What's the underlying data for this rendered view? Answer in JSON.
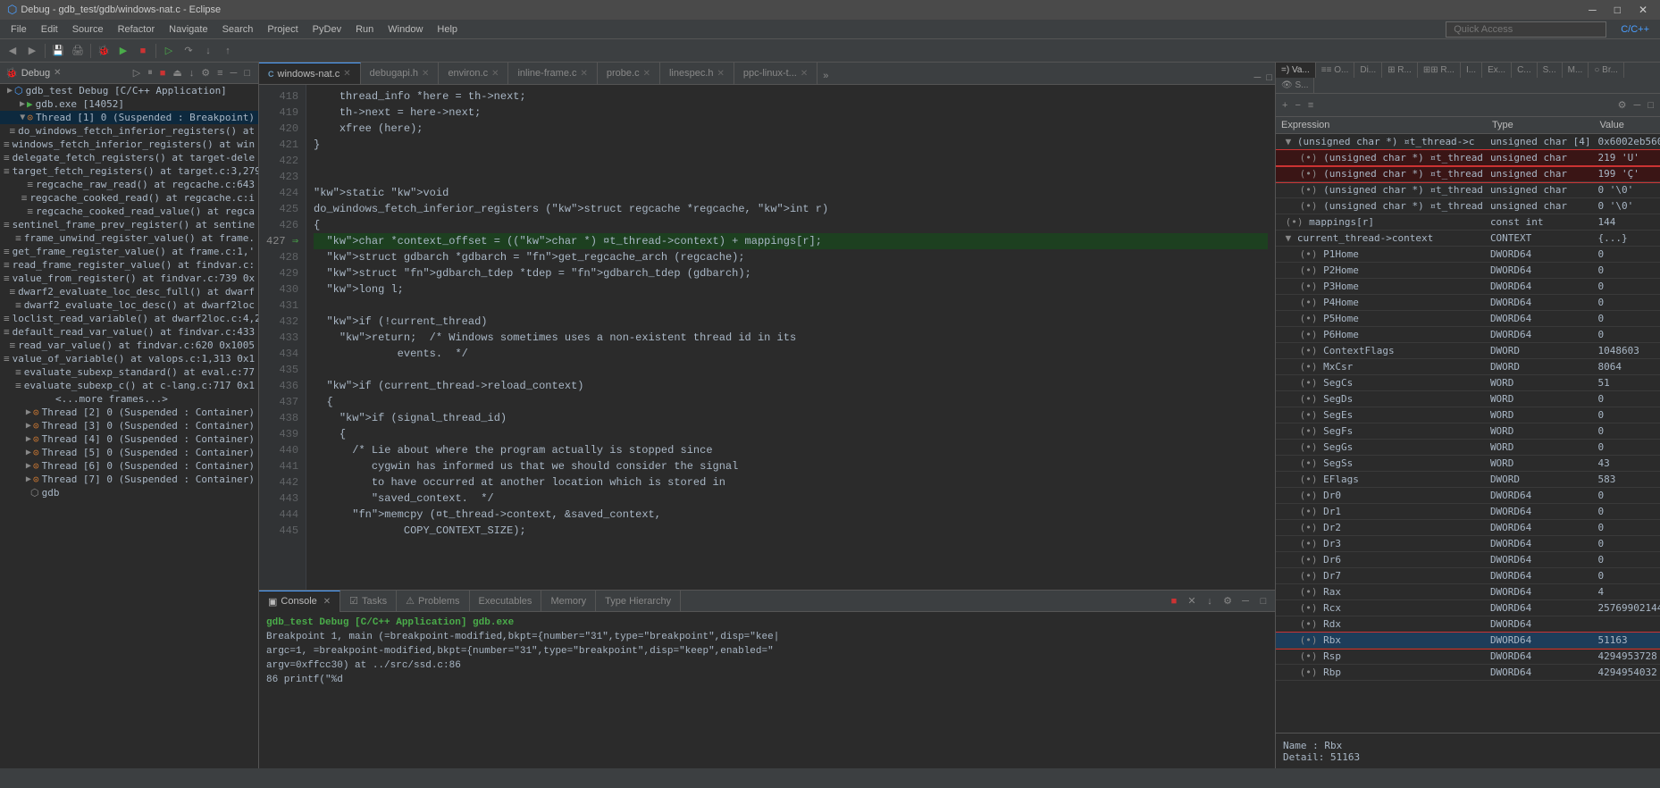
{
  "titleBar": {
    "title": "Debug - gdb_test/gdb/windows-nat.c - Eclipse",
    "controls": [
      "─",
      "□",
      "✕"
    ]
  },
  "menuBar": {
    "items": [
      "File",
      "Edit",
      "Source",
      "Refactor",
      "Navigate",
      "Search",
      "Project",
      "PyDev",
      "Run",
      "Window",
      "Help"
    ]
  },
  "toolbar": {
    "quickAccess": "Quick Access",
    "perspective": "C/C++"
  },
  "debugPanel": {
    "title": "Debug",
    "tree": [
      {
        "indent": 0,
        "icon": "▶",
        "label": "gdb_test Debug [C/C++ Application]",
        "type": "app"
      },
      {
        "indent": 1,
        "icon": "▶",
        "label": "gdb.exe [14052]",
        "type": "process"
      },
      {
        "indent": 2,
        "icon": "▼",
        "label": "Thread [1] 0 (Suspended : Breakpoint)",
        "type": "thread",
        "active": true
      },
      {
        "indent": 3,
        "label": "do_windows_fetch_inferior_registers() at",
        "type": "frame"
      },
      {
        "indent": 3,
        "label": "windows_fetch_inferior_registers() at win",
        "type": "frame"
      },
      {
        "indent": 3,
        "label": "delegate_fetch_registers() at target-dele",
        "type": "frame"
      },
      {
        "indent": 3,
        "label": "target_fetch_registers() at target.c:3,279",
        "type": "frame"
      },
      {
        "indent": 3,
        "label": "regcache_raw_read() at regcache.c:643",
        "type": "frame"
      },
      {
        "indent": 3,
        "label": "regcache_cooked_read() at regcache.c:i",
        "type": "frame"
      },
      {
        "indent": 3,
        "label": "regcache_cooked_read_value() at regca",
        "type": "frame"
      },
      {
        "indent": 3,
        "label": "sentinel_frame_prev_register() at sentine",
        "type": "frame"
      },
      {
        "indent": 3,
        "label": "frame_unwind_register_value() at frame.",
        "type": "frame"
      },
      {
        "indent": 3,
        "label": "get_frame_register_value() at frame.c:1,'",
        "type": "frame"
      },
      {
        "indent": 3,
        "label": "read_frame_register_value() at findvar.c:",
        "type": "frame"
      },
      {
        "indent": 3,
        "label": "value_from_register() at findvar.c:739 0x",
        "type": "frame"
      },
      {
        "indent": 3,
        "label": "dwarf2_evaluate_loc_desc_full() at dwarf",
        "type": "frame"
      },
      {
        "indent": 3,
        "label": "dwarf2_evaluate_loc_desc() at dwarf2loc",
        "type": "frame"
      },
      {
        "indent": 3,
        "label": "loclist_read_variable() at dwarf2loc.c:4,2",
        "type": "frame"
      },
      {
        "indent": 3,
        "label": "default_read_var_value() at findvar.c:433",
        "type": "frame"
      },
      {
        "indent": 3,
        "label": "read_var_value() at findvar.c:620 0x1005",
        "type": "frame"
      },
      {
        "indent": 3,
        "label": "value_of_variable() at valops.c:1,313 0x1",
        "type": "frame"
      },
      {
        "indent": 3,
        "label": "evaluate_subexp_standard() at eval.c:77",
        "type": "frame"
      },
      {
        "indent": 3,
        "label": "evaluate_subexp_c() at c-lang.c:717 0x1",
        "type": "frame"
      },
      {
        "indent": 3,
        "label": "<...more frames...>",
        "type": "more"
      },
      {
        "indent": 2,
        "icon": "▶",
        "label": "Thread [2] 0 (Suspended : Container)",
        "type": "thread"
      },
      {
        "indent": 2,
        "icon": "▶",
        "label": "Thread [3] 0 (Suspended : Container)",
        "type": "thread"
      },
      {
        "indent": 2,
        "icon": "▶",
        "label": "Thread [4] 0 (Suspended : Container)",
        "type": "thread"
      },
      {
        "indent": 2,
        "icon": "▶",
        "label": "Thread [5] 0 (Suspended : Container)",
        "type": "thread"
      },
      {
        "indent": 2,
        "icon": "▶",
        "label": "Thread [6] 0 (Suspended : Container)",
        "type": "thread"
      },
      {
        "indent": 2,
        "icon": "▶",
        "label": "Thread [7] 0 (Suspended : Container)",
        "type": "thread"
      },
      {
        "indent": 1,
        "label": "gdb",
        "type": "gdb"
      }
    ]
  },
  "editorTabs": {
    "tabs": [
      {
        "label": "windows-nat.c",
        "active": true,
        "icon": "C"
      },
      {
        "label": "debugapi.h",
        "active": false
      },
      {
        "label": "environ.c",
        "active": false
      },
      {
        "label": "inline-frame.c",
        "active": false
      },
      {
        "label": "probe.c",
        "active": false
      },
      {
        "label": "linespec.h",
        "active": false
      },
      {
        "label": "ppc-linux-t...",
        "active": false
      }
    ],
    "more": "»"
  },
  "codeLines": [
    {
      "num": 418,
      "code": "    thread_info *here = th->next;",
      "highlight": false
    },
    {
      "num": 419,
      "code": "    th->next = here->next;",
      "highlight": false
    },
    {
      "num": 420,
      "code": "    xfree (here);",
      "highlight": false
    },
    {
      "num": 421,
      "code": "}",
      "highlight": false
    },
    {
      "num": 422,
      "code": "",
      "highlight": false
    },
    {
      "num": 423,
      "code": "",
      "highlight": false
    },
    {
      "num": 424,
      "code": "static void",
      "highlight": false
    },
    {
      "num": 425,
      "code": "do_windows_fetch_inferior_registers (struct regcache *regcache, int r)",
      "highlight": false
    },
    {
      "num": 426,
      "code": "{",
      "highlight": false
    },
    {
      "num": 427,
      "code": "  char *context_offset = ((char *) &current_thread->context) + mappings[r];",
      "highlight": true
    },
    {
      "num": 428,
      "code": "  struct gdbarch *gdbarch = get_regcache_arch (regcache);",
      "highlight": false
    },
    {
      "num": 429,
      "code": "  struct gdbarch_tdep *tdep = gdbarch_tdep (gdbarch);",
      "highlight": false
    },
    {
      "num": 430,
      "code": "  long l;",
      "highlight": false
    },
    {
      "num": 431,
      "code": "",
      "highlight": false
    },
    {
      "num": 432,
      "code": "  if (!current_thread)",
      "highlight": false
    },
    {
      "num": 433,
      "code": "    return;  /* Windows sometimes uses a non-existent thread id in its",
      "highlight": false
    },
    {
      "num": 434,
      "code": "             events.  */",
      "highlight": false
    },
    {
      "num": 435,
      "code": "",
      "highlight": false
    },
    {
      "num": 436,
      "code": "  if (current_thread->reload_context)",
      "highlight": false
    },
    {
      "num": 437,
      "code": "  {",
      "highlight": false
    },
    {
      "num": 438,
      "code": "    if (signal_thread_id)",
      "highlight": false
    },
    {
      "num": 439,
      "code": "    {",
      "highlight": false
    },
    {
      "num": 440,
      "code": "      /* Lie about where the program actually is stopped since",
      "highlight": false
    },
    {
      "num": 441,
      "code": "         cygwin has informed us that we should consider the signal",
      "highlight": false
    },
    {
      "num": 442,
      "code": "         to have occurred at another location which is stored in",
      "highlight": false
    },
    {
      "num": 443,
      "code": "         \"saved_context.  */",
      "highlight": false
    },
    {
      "num": 444,
      "code": "      memcpy (&current_thread->context, &saved_context,",
      "highlight": false
    },
    {
      "num": 445,
      "code": "              COPY_CONTEXT_SIZE);",
      "highlight": false
    }
  ],
  "rightPanel": {
    "tabs": [
      {
        "label": "=) Va...",
        "active": true
      },
      {
        "label": "≡≡ O...",
        "active": false
      },
      {
        "label": "Di...",
        "active": false
      },
      {
        "label": "⊞⊞ R...",
        "active": false
      },
      {
        "label": "≡ R...",
        "active": false
      },
      {
        "label": "I...",
        "active": false
      },
      {
        "label": "Ex...",
        "active": false
      },
      {
        "label": "C...",
        "active": false
      },
      {
        "label": "S...",
        "active": false
      },
      {
        "label": "M...",
        "active": false
      },
      {
        "label": "○ Br...",
        "active": false
      },
      {
        "label": "👁 S...",
        "active": false
      }
    ],
    "tableHeaders": [
      "Expression",
      "Type",
      "Value"
    ],
    "variables": [
      {
        "indent": 0,
        "expand": "▼",
        "name": "(unsigned char *) &current_thread->c",
        "type": "unsigned char [4]",
        "value": "0x6002eb560",
        "selected": false,
        "redOutline": false
      },
      {
        "indent": 1,
        "expand": "(•)",
        "name": "(unsigned char *) &current_thread",
        "type": "unsigned char",
        "value": "219 'U'",
        "selected": false,
        "redOutline": true
      },
      {
        "indent": 1,
        "expand": "(•)",
        "name": "(unsigned char *) &current_thread",
        "type": "unsigned char",
        "value": "199 'Ç'",
        "selected": false,
        "redOutline": true
      },
      {
        "indent": 1,
        "expand": "(•)",
        "name": "(unsigned char *) &current_thread",
        "type": "unsigned char",
        "value": "0 '\\0'",
        "selected": false,
        "redOutline": false
      },
      {
        "indent": 1,
        "expand": "(•)",
        "name": "(unsigned char *) &current_thread",
        "type": "unsigned char",
        "value": "0 '\\0'",
        "selected": false,
        "redOutline": false
      },
      {
        "indent": 0,
        "expand": "(•)",
        "name": "mappings[r]",
        "type": "const int",
        "value": "144",
        "selected": false,
        "redOutline": false
      },
      {
        "indent": 0,
        "expand": "▼",
        "name": "current_thread->context",
        "type": "CONTEXT",
        "value": "{...}",
        "selected": false,
        "redOutline": false
      },
      {
        "indent": 1,
        "expand": "(•)",
        "name": "P1Home",
        "type": "DWORD64",
        "value": "0",
        "selected": false,
        "redOutline": false
      },
      {
        "indent": 1,
        "expand": "(•)",
        "name": "P2Home",
        "type": "DWORD64",
        "value": "0",
        "selected": false,
        "redOutline": false
      },
      {
        "indent": 1,
        "expand": "(•)",
        "name": "P3Home",
        "type": "DWORD64",
        "value": "0",
        "selected": false,
        "redOutline": false
      },
      {
        "indent": 1,
        "expand": "(•)",
        "name": "P4Home",
        "type": "DWORD64",
        "value": "0",
        "selected": false,
        "redOutline": false
      },
      {
        "indent": 1,
        "expand": "(•)",
        "name": "P5Home",
        "type": "DWORD64",
        "value": "0",
        "selected": false,
        "redOutline": false
      },
      {
        "indent": 1,
        "expand": "(•)",
        "name": "P6Home",
        "type": "DWORD64",
        "value": "0",
        "selected": false,
        "redOutline": false
      },
      {
        "indent": 1,
        "expand": "(•)",
        "name": "ContextFlags",
        "type": "DWORD",
        "value": "1048603",
        "selected": false,
        "redOutline": false
      },
      {
        "indent": 1,
        "expand": "(•)",
        "name": "MxCsr",
        "type": "DWORD",
        "value": "8064",
        "selected": false,
        "redOutline": false
      },
      {
        "indent": 1,
        "expand": "(•)",
        "name": "SegCs",
        "type": "WORD",
        "value": "51",
        "selected": false,
        "redOutline": false
      },
      {
        "indent": 1,
        "expand": "(•)",
        "name": "SegDs",
        "type": "WORD",
        "value": "0",
        "selected": false,
        "redOutline": false
      },
      {
        "indent": 1,
        "expand": "(•)",
        "name": "SegEs",
        "type": "WORD",
        "value": "0",
        "selected": false,
        "redOutline": false
      },
      {
        "indent": 1,
        "expand": "(•)",
        "name": "SegFs",
        "type": "WORD",
        "value": "0",
        "selected": false,
        "redOutline": false
      },
      {
        "indent": 1,
        "expand": "(•)",
        "name": "SegGs",
        "type": "WORD",
        "value": "0",
        "selected": false,
        "redOutline": false
      },
      {
        "indent": 1,
        "expand": "(•)",
        "name": "SegSs",
        "type": "WORD",
        "value": "43",
        "selected": false,
        "redOutline": false
      },
      {
        "indent": 1,
        "expand": "(•)",
        "name": "EFlags",
        "type": "DWORD",
        "value": "583",
        "selected": false,
        "redOutline": false
      },
      {
        "indent": 1,
        "expand": "(•)",
        "name": "Dr0",
        "type": "DWORD64",
        "value": "0",
        "selected": false,
        "redOutline": false
      },
      {
        "indent": 1,
        "expand": "(•)",
        "name": "Dr1",
        "type": "DWORD64",
        "value": "0",
        "selected": false,
        "redOutline": false
      },
      {
        "indent": 1,
        "expand": "(•)",
        "name": "Dr2",
        "type": "DWORD64",
        "value": "0",
        "selected": false,
        "redOutline": false
      },
      {
        "indent": 1,
        "expand": "(•)",
        "name": "Dr3",
        "type": "DWORD64",
        "value": "0",
        "selected": false,
        "redOutline": false
      },
      {
        "indent": 1,
        "expand": "(•)",
        "name": "Dr6",
        "type": "DWORD64",
        "value": "0",
        "selected": false,
        "redOutline": false
      },
      {
        "indent": 1,
        "expand": "(•)",
        "name": "Dr7",
        "type": "DWORD64",
        "value": "0",
        "selected": false,
        "redOutline": false
      },
      {
        "indent": 1,
        "expand": "(•)",
        "name": "Rax",
        "type": "DWORD64",
        "value": "4",
        "selected": false,
        "redOutline": false
      },
      {
        "indent": 1,
        "expand": "(•)",
        "name": "Rcx",
        "type": "DWORD64",
        "value": "25769902144",
        "selected": false,
        "redOutline": false
      },
      {
        "indent": 1,
        "expand": "(•)",
        "name": "Rdx",
        "type": "DWORD64",
        "value": "",
        "selected": false,
        "redOutline": false
      },
      {
        "indent": 1,
        "expand": "(•)",
        "name": "Rbx",
        "type": "DWORD64",
        "value": "51163",
        "selected": true,
        "redOutline": true
      },
      {
        "indent": 1,
        "expand": "(•)",
        "name": "Rsp",
        "type": "DWORD64",
        "value": "4294953728",
        "selected": false,
        "redOutline": false
      },
      {
        "indent": 1,
        "expand": "(•)",
        "name": "Rbp",
        "type": "DWORD64",
        "value": "4294954032",
        "selected": false,
        "redOutline": false
      }
    ]
  },
  "bottomPanel": {
    "tabs": [
      {
        "label": "Console",
        "active": true,
        "icon": "▣"
      },
      {
        "label": "Tasks",
        "active": false
      },
      {
        "label": "Problems",
        "active": false
      },
      {
        "label": "Executables",
        "active": false
      },
      {
        "label": "Memory",
        "active": false
      },
      {
        "label": "Type Hierarchy",
        "active": false
      }
    ],
    "consoleTitle": "gdb_test Debug [C/C++ Application] gdb.exe",
    "consoleContent": [
      "Breakpoint 1, main (=breakpoint-modified,bkpt={number=\"31\",type=\"breakpoint\",disp=\"kee|",
      "argc=1, =breakpoint-modified,bkpt={number=\"31\",type=\"breakpoint\",disp=\"keep\",enabled=\"",
      "argv=0xffcc30) at ../src/ssd.c:86",
      "86      printf(\"%d"
    ]
  },
  "nameDetailBar": {
    "name": "Name : Rbx",
    "detail": "Detail: 51163"
  }
}
